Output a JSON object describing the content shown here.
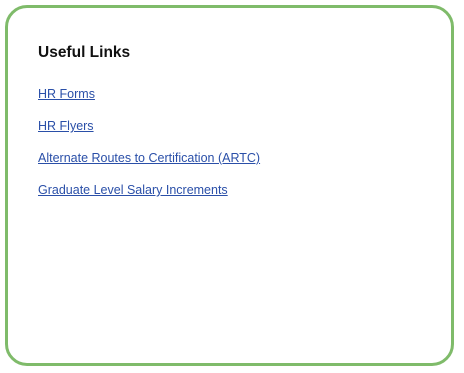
{
  "panel": {
    "title": "Useful Links",
    "links": [
      {
        "label": "HR Forms"
      },
      {
        "label": "HR Flyers"
      },
      {
        "label": "Alternate Routes to Certification (ARTC)"
      },
      {
        "label": "Graduate Level Salary Increments"
      }
    ]
  },
  "colors": {
    "border": "#7fbb6a",
    "link": "#2a4fa8",
    "title": "#111111"
  }
}
